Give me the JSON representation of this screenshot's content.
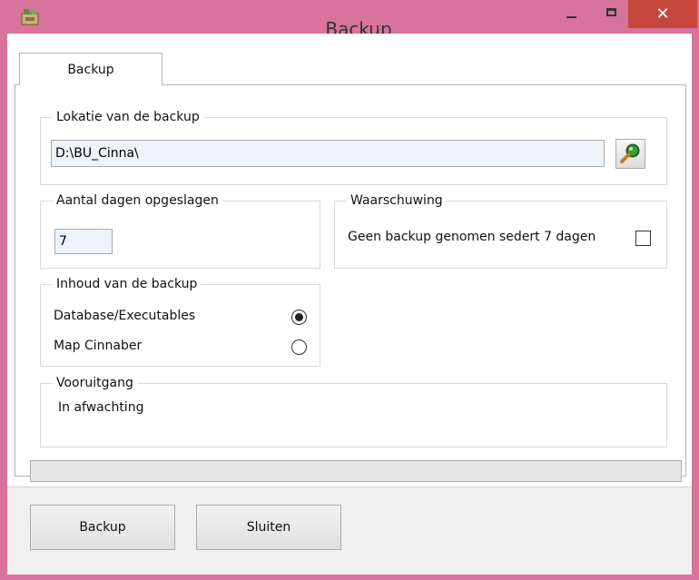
{
  "window": {
    "title": "Backup"
  },
  "tabs": [
    {
      "label": "Backup",
      "active": true
    }
  ],
  "location": {
    "legend": "Lokatie van de backup",
    "path": "D:\\BU_Cinna\\"
  },
  "days": {
    "legend": "Aantal dagen opgeslagen",
    "value": "7"
  },
  "warning": {
    "legend": "Waarschuwing",
    "label": "Geen backup genomen sedert 7 dagen",
    "checked": false
  },
  "content": {
    "legend": "Inhoud van de backup",
    "options": [
      {
        "label": "Database/Executables",
        "selected": true
      },
      {
        "label": "Map Cinnaber",
        "selected": false
      }
    ]
  },
  "progress": {
    "legend": "Vooruitgang",
    "status": "In afwachting",
    "fraction": 0
  },
  "buttons": {
    "backup": "Backup",
    "close": "Sluiten"
  },
  "colors": {
    "frame": "#d8739b",
    "close_button": "#c7463c",
    "input_bg": "#ecf3fb"
  },
  "icons": {
    "app": "app-icon",
    "browse": "magnifier-icon"
  }
}
